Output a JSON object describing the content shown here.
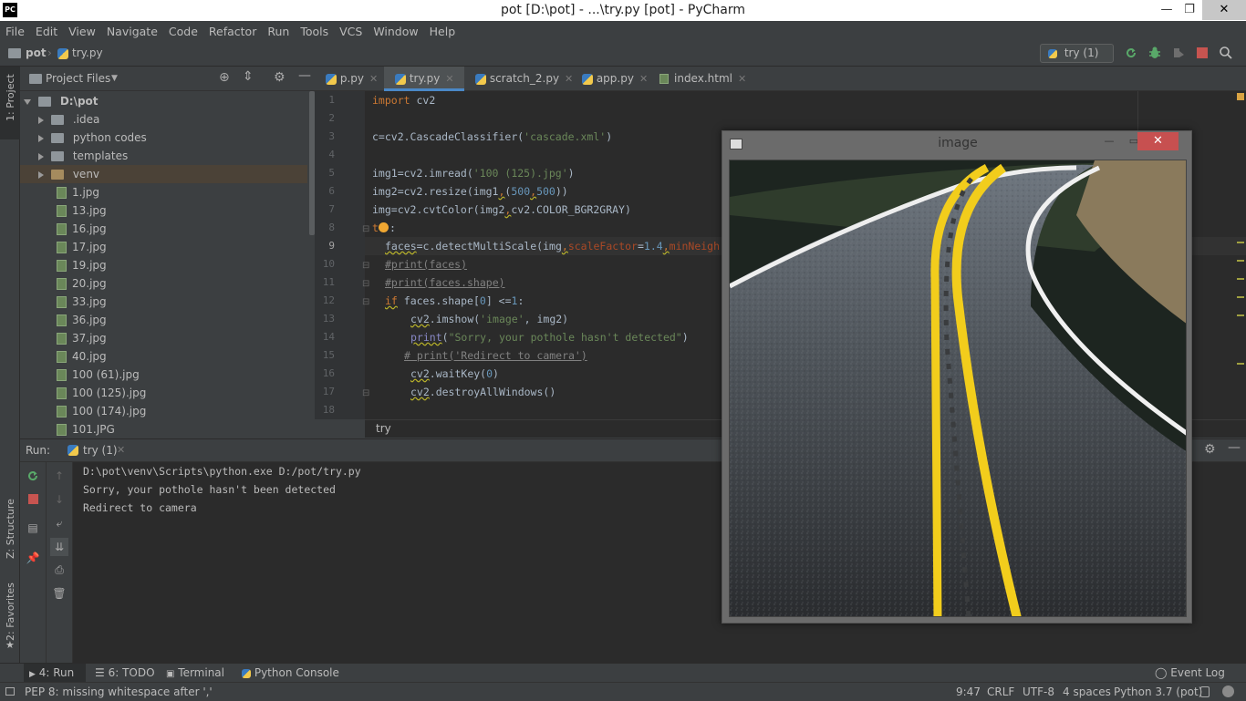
{
  "window": {
    "title": "pot [D:\\pot] - ...\\try.py [pot] - PyCharm",
    "app_icon": "PC",
    "minimize": "—",
    "maximize": "❐",
    "close": "✕"
  },
  "menu": [
    "File",
    "Edit",
    "View",
    "Navigate",
    "Code",
    "Refactor",
    "Run",
    "Tools",
    "VCS",
    "Window",
    "Help"
  ],
  "navbar": {
    "crumbs": [
      "pot",
      "try.py"
    ],
    "run_config": "try (1)"
  },
  "left_strip": {
    "project": "1: Project",
    "structure": "Z: Structure",
    "favorites": "2: Favorites"
  },
  "project_panel": {
    "title": "Project Files",
    "root": "D:\\pot",
    "folders": [
      ".idea",
      "python codes",
      "templates",
      "venv"
    ],
    "files": [
      "1.jpg",
      "13.jpg",
      "16.jpg",
      "17.jpg",
      "19.jpg",
      "20.jpg",
      "33.jpg",
      "36.jpg",
      "37.jpg",
      "40.jpg",
      "100 (61).jpg",
      "100 (125).jpg",
      "100 (174).jpg",
      "101.JPG"
    ]
  },
  "editor": {
    "tabs": [
      "p.py",
      "try.py",
      "scratch_2.py",
      "app.py",
      "index.html"
    ],
    "active_tab": "try.py",
    "line_numbers": [
      "1",
      "2",
      "3",
      "4",
      "5",
      "6",
      "7",
      "8",
      "9",
      "10",
      "11",
      "12",
      "13",
      "14",
      "15",
      "16",
      "17",
      "18"
    ],
    "breadcrumb": "try"
  },
  "code": {
    "l1_kw": "import",
    "l1_rest": " cv2",
    "l3_a": "c=cv2.CascadeClassifier(",
    "l3_s": "'cascade.xml'",
    "l3_b": ")",
    "l5_a": "img1=cv2.imread(",
    "l5_s": "'100 (125).jpg'",
    "l5_b": ")",
    "l6_a": "img2=cv2.resize(img1",
    "l6_c": ",",
    "l6_b": "(",
    "l6_n1": "500",
    "l6_c2": ",",
    "l6_n2": "500",
    "l6_e": "))",
    "l7_a": "img=cv2.cvtColor(img2",
    "l7_c": ",",
    "l7_b": "cv2.COLOR_BGR2GRAY)",
    "l8": "t",
    "l8_colon": ":",
    "l9_a": "faces",
    "l9_b": "=c.detectMultiScale(img",
    "l9_c": ",",
    "l9_p1": "scaleFactor",
    "l9_d": "=",
    "l9_n": "1.4",
    "l9_c2": ",",
    "l9_p2": "minNeigh",
    "l10": "#print(faces)",
    "l11": "#print(faces.shape)",
    "l12_kw": "if",
    "l12_a": " faces.shape[",
    "l12_n": "0",
    "l12_b": "] <=",
    "l12_n2": "1",
    "l12_c": ":",
    "l13_a": "cv2",
    "l13_b": ".imshow(",
    "l13_s": "'image'",
    "l13_c": ", img2)",
    "l14_a": "print",
    "l14_b": "(",
    "l14_s": "\"Sorry, your pothole hasn't detected\"",
    "l14_c": ")",
    "l15": "# print('Redirect to camera')",
    "l16_a": "cv2",
    "l16_b": ".waitKey(",
    "l16_n": "0",
    "l16_c": ")",
    "l17_a": "cv2",
    "l17_b": ".destroyAllWindows()"
  },
  "run": {
    "label": "Run:",
    "tab": "try (1)",
    "output": [
      "D:\\pot\\venv\\Scripts\\python.exe D:/pot/try.py",
      "Sorry, your pothole hasn't been detected",
      "Redirect to camera"
    ]
  },
  "bottom_tabs": [
    "4: Run",
    "6: TODO",
    "Terminal",
    "Python Console"
  ],
  "event_log": "Event Log",
  "status": {
    "message": "PEP 8: missing whitespace after ','",
    "position": "9:47",
    "line_sep": "CRLF",
    "encoding": "UTF-8",
    "indent": "4 spaces",
    "interpreter": "Python 3.7 (pot)"
  },
  "image_window": {
    "title": "image",
    "close": "✕"
  },
  "colors": {
    "accent": "#4a88c7",
    "keyword": "#cc7832",
    "string": "#6a8759",
    "number": "#6897bb",
    "comment": "#808080"
  }
}
